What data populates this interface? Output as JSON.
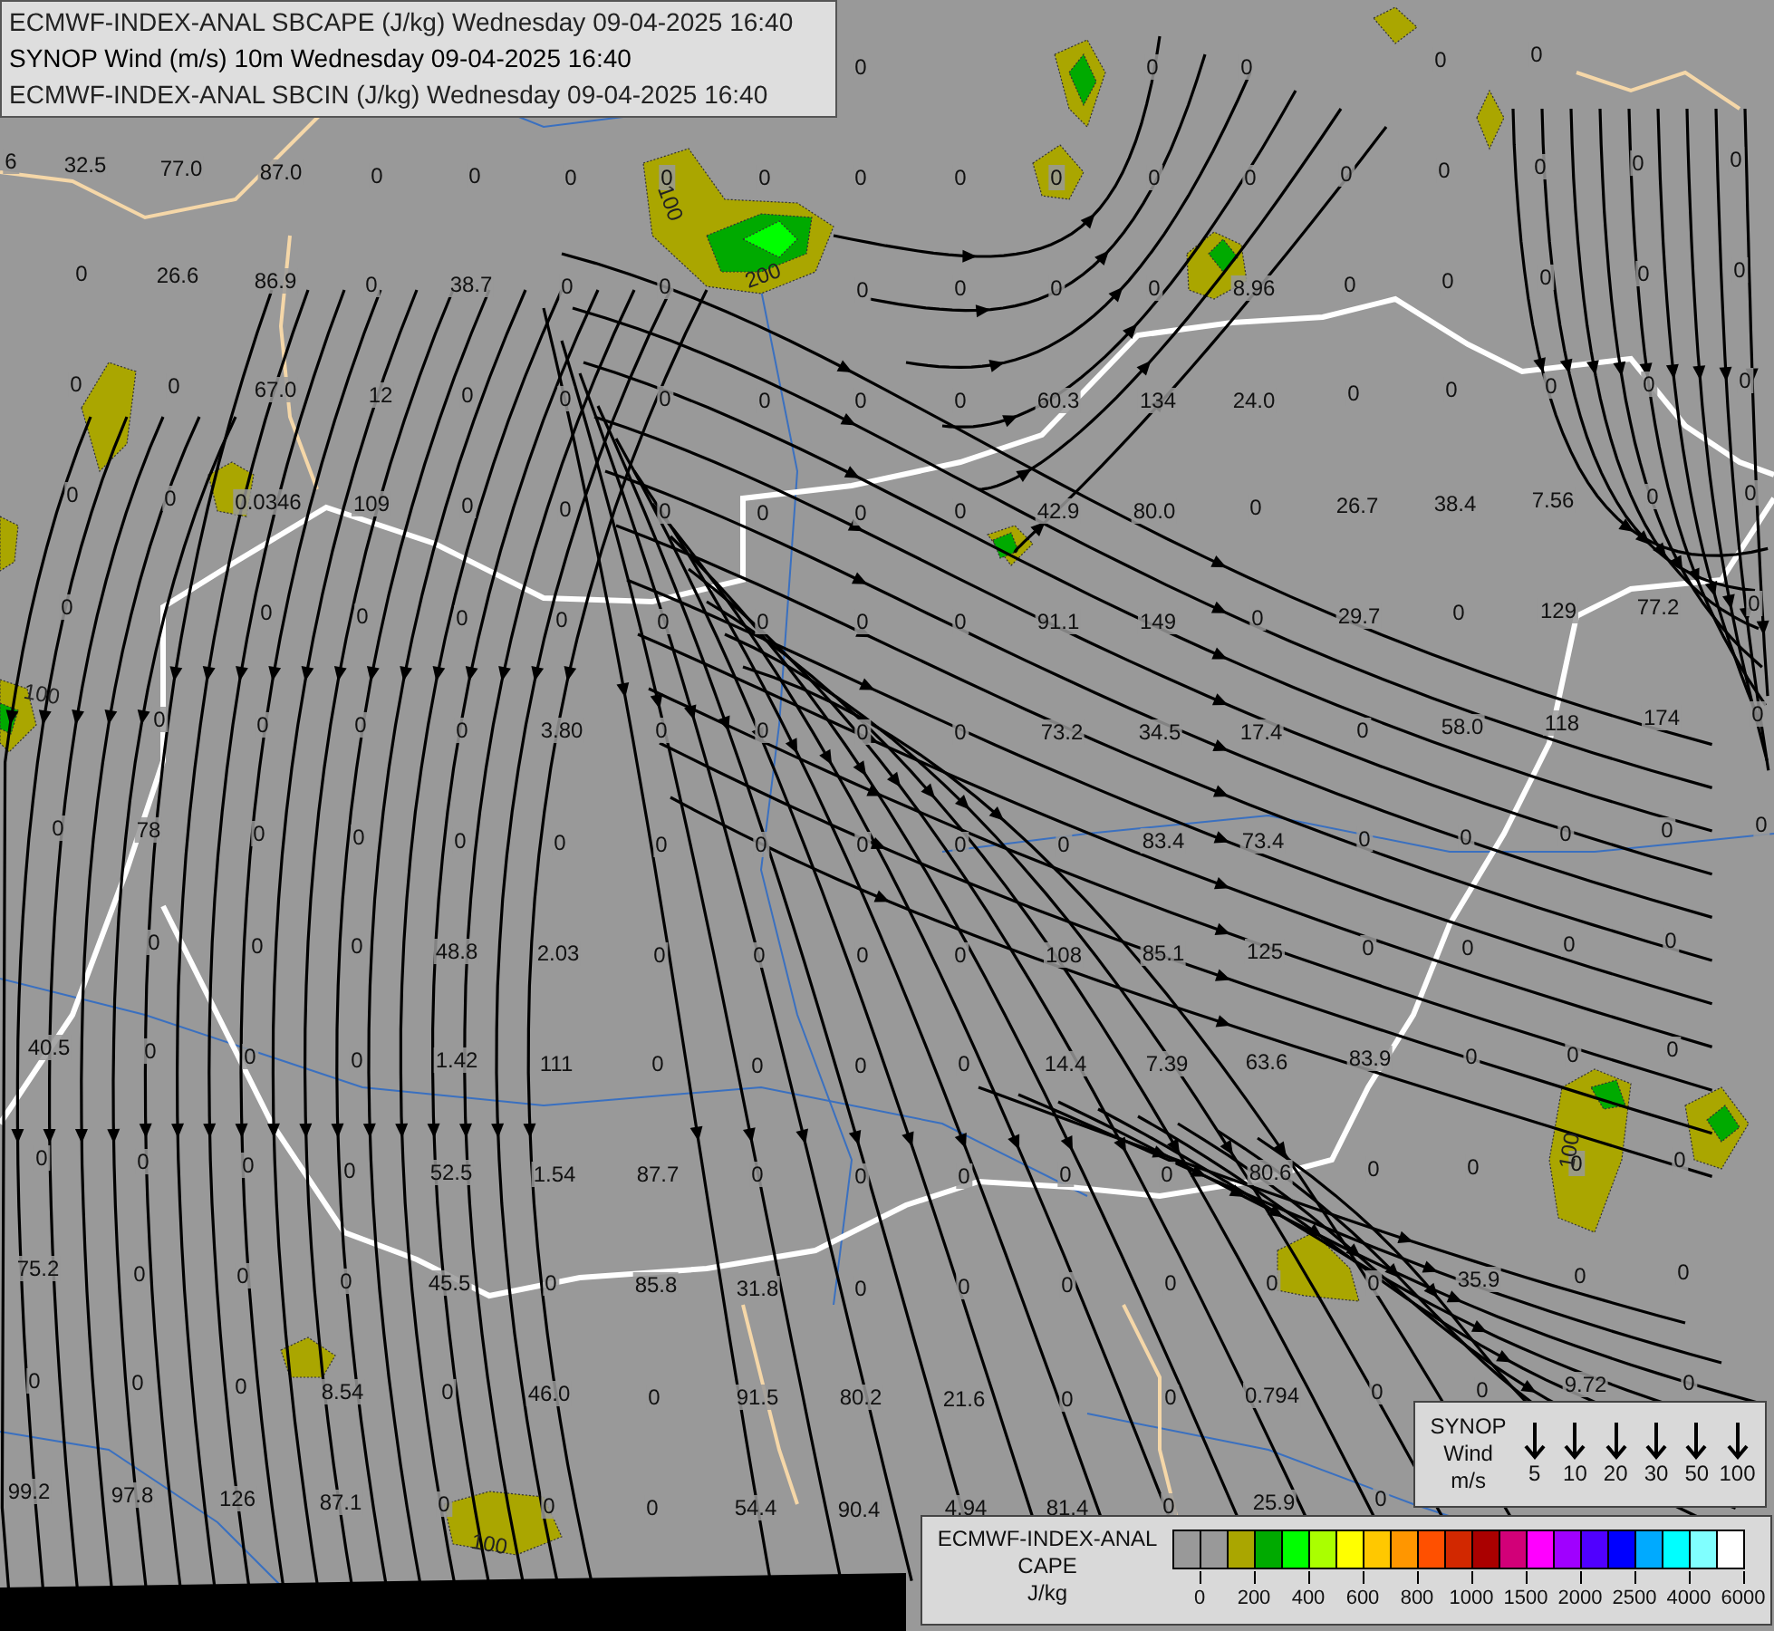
{
  "header": {
    "lines": [
      "ECMWF-INDEX-ANAL SBCAPE (J/kg) Wednesday 09-04-2025 16:40",
      "SYNOP Wind (m/s) 10m Wednesday 09-04-2025 16:40",
      "ECMWF-INDEX-ANAL SBCIN (J/kg) Wednesday 09-04-2025 16:40"
    ]
  },
  "map": {
    "value_rows": [
      [
        "0",
        "0",
        "0",
        "0",
        "0"
      ],
      [
        "6",
        "32.5",
        "77.0",
        "87.0",
        "0",
        "0",
        "0",
        "0",
        "0",
        "0",
        "0",
        "0",
        "0",
        "0",
        "0",
        "0",
        "0",
        "0",
        "0"
      ],
      [
        "0",
        "26.6",
        "86.9",
        "0",
        "38.7",
        "0",
        "0",
        "0",
        "0",
        "0",
        "0",
        "8.96",
        "0",
        "0",
        "0",
        "0",
        "0"
      ],
      [
        "0",
        "0",
        "67.0",
        "12",
        "0",
        "0",
        "0",
        "0",
        "0",
        "0",
        "60.3",
        "134",
        "24.0",
        "0",
        "0",
        "0",
        "0",
        "0"
      ],
      [
        "0",
        "0",
        "0.0346",
        "109",
        "0",
        "0",
        "0",
        "0",
        "0",
        "0",
        "42.9",
        "80.0",
        "0",
        "26.7",
        "38.4",
        "7.56",
        "0",
        "0"
      ],
      [
        "0",
        "0",
        "0",
        "0",
        "0",
        "0",
        "0",
        "0",
        "0",
        "91.1",
        "149",
        "0",
        "29.7",
        "0",
        "129",
        "77.2",
        "0"
      ],
      [
        "0",
        "0",
        "0",
        "0",
        "3.80",
        "0",
        "0",
        "0",
        "0",
        "73.2",
        "34.5",
        "17.4",
        "0",
        "58.0",
        "118",
        "174",
        "0"
      ],
      [
        "0",
        "78",
        "0",
        "0",
        "0",
        "0",
        "0",
        "0",
        "0",
        "0",
        "0",
        "83.4",
        "73.4",
        "0",
        "0",
        "0",
        "0",
        "0"
      ],
      [
        "0",
        "0",
        "0",
        "48.8",
        "2.03",
        "0",
        "0",
        "0",
        "0",
        "108",
        "85.1",
        "125",
        "0",
        "0",
        "0",
        "0"
      ],
      [
        "40.5",
        "0",
        "0",
        "0",
        "1.42",
        "111",
        "0",
        "0",
        "0",
        "0",
        "14.4",
        "7.39",
        "63.6",
        "83.9",
        "0",
        "0",
        "0"
      ],
      [
        "0",
        "0",
        "0",
        "0",
        "52.5",
        "1.54",
        "87.7",
        "0",
        "0",
        "0",
        "0",
        "0",
        "80.6",
        "0",
        "0",
        "0",
        "0"
      ],
      [
        "75.2",
        "0",
        "0",
        "0",
        "45.5",
        "0",
        "85.8",
        "31.8",
        "0",
        "0",
        "0",
        "0",
        "0",
        "0",
        "35.9",
        "0",
        "0"
      ],
      [
        "0",
        "0",
        "0",
        "8.54",
        "0",
        "46.0",
        "0",
        "91.5",
        "80.2",
        "21.6",
        "0",
        "0",
        "0.794",
        "0",
        "0",
        "9.72",
        "0"
      ],
      [
        "99.2",
        "97.8",
        "126",
        "87.1",
        "0",
        "0",
        "0",
        "54.4",
        "90.4",
        "4.94",
        "81.4",
        "0",
        "25.9",
        "0"
      ]
    ],
    "contour_labels": [
      "100",
      "200",
      "100",
      "100",
      "100"
    ]
  },
  "wind_legend": {
    "title_lines": [
      "SYNOP",
      "Wind",
      "m/s"
    ],
    "speeds": [
      "5",
      "10",
      "20",
      "30",
      "50",
      "100"
    ]
  },
  "cape_legend": {
    "title_lines": [
      "ECMWF-INDEX-ANAL",
      "CAPE",
      "J/kg"
    ],
    "swatches": [
      {
        "color": "#999999"
      },
      {
        "color": "#999999"
      },
      {
        "color": "#aaa600"
      },
      {
        "color": "#00aa00"
      },
      {
        "color": "#00ff00"
      },
      {
        "color": "#aaff00"
      },
      {
        "color": "#ffff00"
      },
      {
        "color": "#ffc800"
      },
      {
        "color": "#ff9600"
      },
      {
        "color": "#ff5000"
      },
      {
        "color": "#d22800"
      },
      {
        "color": "#aa0000"
      },
      {
        "color": "#d20078"
      },
      {
        "color": "#ff00ff"
      },
      {
        "color": "#a000ff"
      },
      {
        "color": "#5000ff"
      },
      {
        "color": "#0000ff"
      },
      {
        "color": "#00aaff"
      },
      {
        "color": "#00ffff"
      },
      {
        "color": "#80ffff"
      },
      {
        "color": "#ffffff"
      }
    ],
    "ticks": [
      "0",
      "200",
      "400",
      "600",
      "800",
      "1000",
      "1500",
      "2000",
      "2500",
      "4000",
      "6000"
    ]
  }
}
